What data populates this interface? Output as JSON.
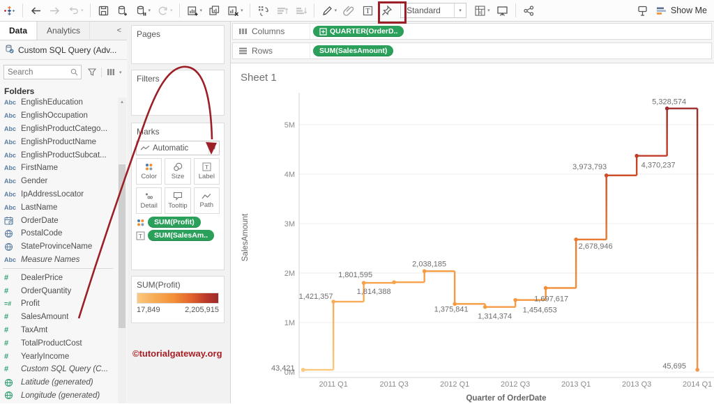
{
  "toolbar": {
    "fit_dropdown_value": "Standard",
    "show_me_label": "Show Me",
    "items": [
      {
        "name": "tableau-logo-icon",
        "icon": "logo",
        "interactable": false
      },
      {
        "name": "separator"
      },
      {
        "name": "undo-button",
        "icon": "back"
      },
      {
        "name": "redo-button",
        "icon": "forward",
        "disabled": true
      },
      {
        "name": "replay-button",
        "icon": "replay",
        "disabled": true,
        "caret": true
      },
      {
        "name": "separator"
      },
      {
        "name": "save-button",
        "icon": "save"
      },
      {
        "name": "add-data-source-button",
        "icon": "db-add"
      },
      {
        "name": "pause-updates-button",
        "icon": "db-pause",
        "caret": true
      },
      {
        "name": "refresh-data-button",
        "icon": "refresh",
        "disabled": true,
        "caret": true
      },
      {
        "name": "separator"
      },
      {
        "name": "new-worksheet-button",
        "icon": "sheet-new",
        "caret": true
      },
      {
        "name": "duplicate-sheet-button",
        "icon": "duplicate"
      },
      {
        "name": "clear-sheet-button",
        "icon": "sheet-clear",
        "caret": true
      },
      {
        "name": "separator"
      },
      {
        "name": "swap-rows-columns-button",
        "icon": "swap"
      },
      {
        "name": "sort-ascending-button",
        "icon": "sort-asc",
        "disabled": true
      },
      {
        "name": "sort-descending-button",
        "icon": "sort-desc",
        "disabled": true
      },
      {
        "name": "separator"
      },
      {
        "name": "highlight-button",
        "icon": "pen",
        "caret": true
      },
      {
        "name": "group-members-button",
        "icon": "clip",
        "disabled": true
      },
      {
        "name": "show-mark-labels-button",
        "icon": "text-label",
        "highlighted": true
      },
      {
        "name": "fix-axes-button",
        "icon": "pin"
      },
      {
        "name": "fit-select"
      },
      {
        "name": "show-hide-cards-button",
        "icon": "cards",
        "caret": true
      },
      {
        "name": "presentation-mode-button",
        "icon": "present"
      },
      {
        "name": "separator"
      },
      {
        "name": "share-workbook-button",
        "icon": "share"
      },
      {
        "name": "spacer"
      },
      {
        "name": "tooltip-command-button",
        "icon": "flag"
      },
      {
        "name": "show-me-button"
      }
    ]
  },
  "sidebar": {
    "tabs": [
      {
        "label": "Data",
        "active": true
      },
      {
        "label": "Analytics",
        "active": false
      }
    ],
    "collapse_glyph": "<",
    "datasource_label": "Custom SQL Query (Adv...",
    "search_placeholder": "Search",
    "folders_label": "Folders",
    "fields": [
      {
        "icon": "abc",
        "label": "EnglishEducation"
      },
      {
        "icon": "abc",
        "label": "EnglishOccupation"
      },
      {
        "icon": "abc",
        "label": "EnglishProductCatego..."
      },
      {
        "icon": "abc",
        "label": "EnglishProductName"
      },
      {
        "icon": "abc",
        "label": "EnglishProductSubcat..."
      },
      {
        "icon": "abc",
        "label": "FirstName"
      },
      {
        "icon": "abc",
        "label": "Gender"
      },
      {
        "icon": "abc",
        "label": "IpAddressLocator"
      },
      {
        "icon": "abc",
        "label": "LastName"
      },
      {
        "icon": "calendar",
        "label": "OrderDate"
      },
      {
        "icon": "globe-blue",
        "label": "PostalCode"
      },
      {
        "icon": "globe-blue",
        "label": "StateProvinceName"
      },
      {
        "icon": "abc",
        "label": "Measure Names",
        "italic": true
      },
      {
        "divider": true
      },
      {
        "icon": "hash",
        "label": "DealerPrice"
      },
      {
        "icon": "hash",
        "label": "OrderQuantity"
      },
      {
        "icon": "hash-calc",
        "label": "Profit"
      },
      {
        "icon": "hash",
        "label": "SalesAmount"
      },
      {
        "icon": "hash",
        "label": "TaxAmt"
      },
      {
        "icon": "hash",
        "label": "TotalProductCost"
      },
      {
        "icon": "hash",
        "label": "YearlyIncome"
      },
      {
        "icon": "hash",
        "label": "Custom SQL Query (C...",
        "italic": true
      },
      {
        "icon": "globe-green",
        "label": "Latitude (generated)",
        "italic": true
      },
      {
        "icon": "globe-green",
        "label": "Longitude (generated)",
        "italic": true
      }
    ]
  },
  "cards": {
    "pages_label": "Pages",
    "filters_label": "Filters",
    "marks": {
      "title": "Marks",
      "mark_type": "Automatic",
      "buttons": [
        {
          "icon": "color-dots",
          "label": "Color"
        },
        {
          "icon": "size-circles",
          "label": "Size"
        },
        {
          "icon": "label-t",
          "label": "Label"
        },
        {
          "icon": "detail-dots",
          "label": "Detail"
        },
        {
          "icon": "tooltip-bubble",
          "label": "Tooltip"
        },
        {
          "icon": "path-line",
          "label": "Path"
        }
      ],
      "pills": [
        {
          "icon": "color-dots",
          "label": "SUM(Profit)"
        },
        {
          "icon": "label-t",
          "label": "SUM(SalesAm.."
        }
      ]
    },
    "color_legend": {
      "title": "SUM(Profit)",
      "min_label": "17,849",
      "max_label": "2,205,915",
      "gradient_colors": [
        "#fac97f",
        "#f7ab55",
        "#f29038",
        "#df602c",
        "#9c2b2b"
      ]
    }
  },
  "watermark": {
    "text": "©tutorialgateway.org",
    "color": "#a81e24"
  },
  "shelves": {
    "columns_label": "Columns",
    "rows_label": "Rows",
    "columns_pills": [
      {
        "label": "QUARTER(OrderD..",
        "expand_icon": true
      }
    ],
    "rows_pills": [
      {
        "label": "SUM(SalesAmount)"
      }
    ]
  },
  "sheet": {
    "title": "Sheet 1"
  },
  "chart_data": {
    "type": "line",
    "subtype": "step",
    "title": "Sheet 1",
    "xlabel": "Quarter of OrderDate",
    "ylabel": "SalesAmount",
    "ylim": [
      0,
      5500000
    ],
    "grid": true,
    "yticks": [
      "0M",
      "1M",
      "2M",
      "3M",
      "4M",
      "5M"
    ],
    "x_axis_tick_labels": [
      "2011 Q1",
      "2011 Q3",
      "2012 Q1",
      "2012 Q3",
      "2013 Q1",
      "2013 Q3",
      "2014 Q1"
    ],
    "categories": [
      "2010 Q4",
      "2011 Q1",
      "2011 Q2",
      "2011 Q3",
      "2011 Q4",
      "2012 Q1",
      "2012 Q2",
      "2012 Q3",
      "2012 Q4",
      "2013 Q1",
      "2013 Q2",
      "2013 Q3",
      "2013 Q4",
      "2014 Q1"
    ],
    "values": [
      43421,
      1421357,
      1801595,
      1814388,
      2038185,
      1375841,
      1314374,
      1454653,
      1697617,
      2678946,
      3973793,
      4370237,
      5328574,
      45695
    ],
    "point_labels": [
      "43,421",
      "1,421,357",
      "1,801,595",
      "1,814,388",
      "2,038,185",
      "1,375,841",
      "1,314,374",
      "1,454,653",
      "1,697,617",
      "2,678,946",
      "3,973,793",
      "4,370,237",
      "5,328,574",
      "45,695"
    ],
    "point_colors": [
      "#fbc87c",
      "#f8ac59",
      "#f7a14b",
      "#f7a14b",
      "#f69b42",
      "#f69b42",
      "#f69d46",
      "#f5973e",
      "#f28e37",
      "#e97a31",
      "#cf4e27",
      "#c03c28",
      "#9e2b2b",
      "#f0964b"
    ],
    "color_by": "SUM(Profit)",
    "color_range": {
      "min": "17,849",
      "max": "2,205,915"
    },
    "annotation": "drag-SalesAmount-to-Label-arrow"
  }
}
